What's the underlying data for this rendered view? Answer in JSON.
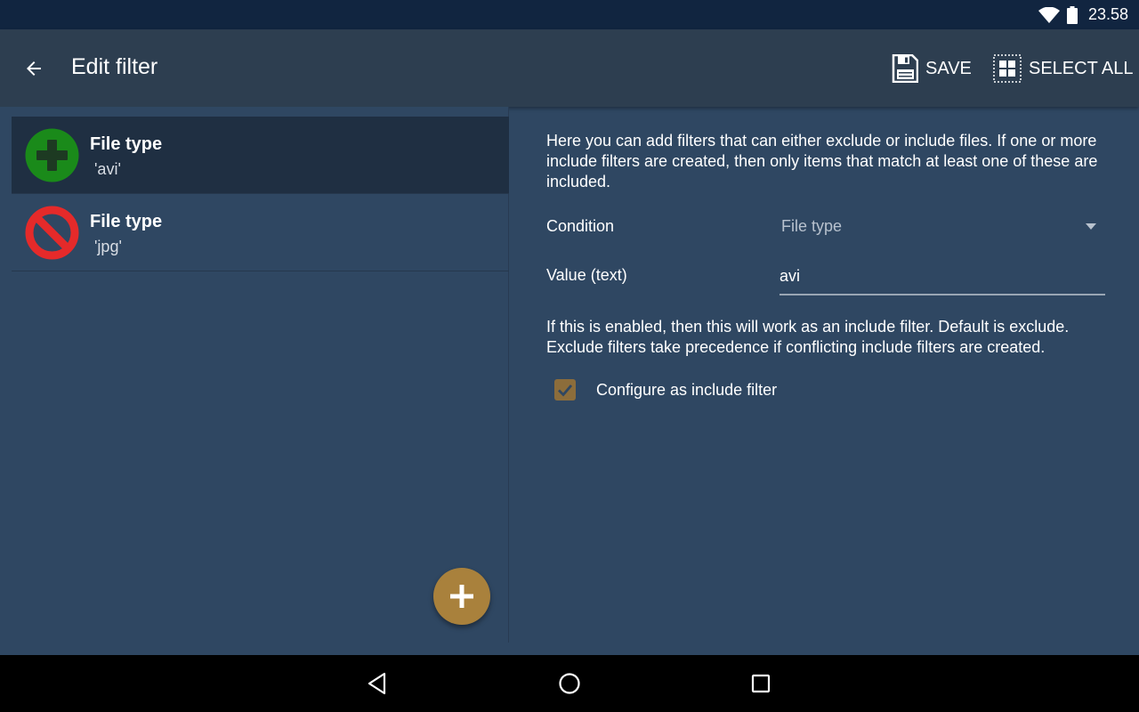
{
  "status": {
    "time": "23.58"
  },
  "toolbar": {
    "title": "Edit filter",
    "save_label": "SAVE",
    "select_all_label": "SELECT ALL"
  },
  "filters": [
    {
      "name": "File type",
      "value": "'avi'",
      "mode": "include",
      "selected": true
    },
    {
      "name": "File type",
      "value": "'jpg'",
      "mode": "exclude",
      "selected": false
    }
  ],
  "detail": {
    "description": "Here you can add filters that can either exclude or include files. If one or more include filters are created, then only items that match at least one of these are included.",
    "condition_label": "Condition",
    "condition_value": "File type",
    "value_label": "Value (text)",
    "value_text": "avi",
    "include_help": "If this is enabled, then this will work as an include filter. Default is exclude. Exclude filters take precedence if conflicting include filters are created.",
    "include_checkbox_label": "Configure as include filter",
    "include_checked": true
  },
  "colors": {
    "accent": "#a9813c",
    "include": "#1a8a1a",
    "exclude": "#e52a2a",
    "toolbar": "#2d3e50",
    "background": "#2f4762"
  }
}
